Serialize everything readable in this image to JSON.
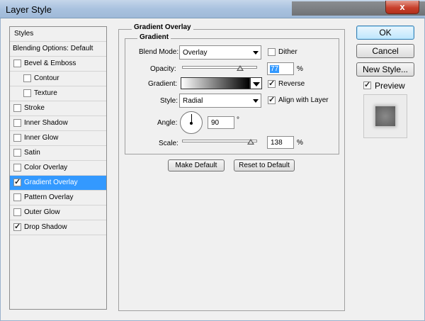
{
  "window": {
    "title": "Layer Style",
    "close_glyph": "x"
  },
  "styles_list": {
    "header": "Styles",
    "blending": "Blending Options: Default",
    "items": [
      {
        "label": "Bevel & Emboss",
        "checked": false
      },
      {
        "label": "Contour",
        "checked": false
      },
      {
        "label": "Texture",
        "checked": false
      },
      {
        "label": "Stroke",
        "checked": false
      },
      {
        "label": "Inner Shadow",
        "checked": false
      },
      {
        "label": "Inner Glow",
        "checked": false
      },
      {
        "label": "Satin",
        "checked": false
      },
      {
        "label": "Color Overlay",
        "checked": false
      },
      {
        "label": "Gradient Overlay",
        "checked": true
      },
      {
        "label": "Pattern Overlay",
        "checked": false
      },
      {
        "label": "Outer Glow",
        "checked": false
      },
      {
        "label": "Drop Shadow",
        "checked": true
      }
    ],
    "check_glyph": "✓"
  },
  "panel": {
    "section_title": "Gradient Overlay",
    "group_title": "Gradient",
    "blend_mode_label": "Blend Mode:",
    "blend_mode_value": "Overlay",
    "dither_label": "Dither",
    "dither_checked": false,
    "opacity_label": "Opacity:",
    "opacity_value": "77",
    "opacity_unit": "%",
    "gradient_label": "Gradient:",
    "reverse_label": "Reverse",
    "reverse_checked": true,
    "style_label": "Style:",
    "style_value": "Radial",
    "align_label": "Align with Layer",
    "align_checked": true,
    "angle_label": "Angle:",
    "angle_value": "90",
    "angle_unit": "°",
    "scale_label": "Scale:",
    "scale_value": "138",
    "scale_unit": "%",
    "make_default": "Make Default",
    "reset_default": "Reset to Default"
  },
  "actions": {
    "ok": "OK",
    "cancel": "Cancel",
    "new_style": "New Style...",
    "preview_label": "Preview",
    "preview_checked": true
  },
  "colors": {
    "selection": "#3399ff",
    "title_bar": "#a9c2df",
    "close": "#c8402c"
  }
}
